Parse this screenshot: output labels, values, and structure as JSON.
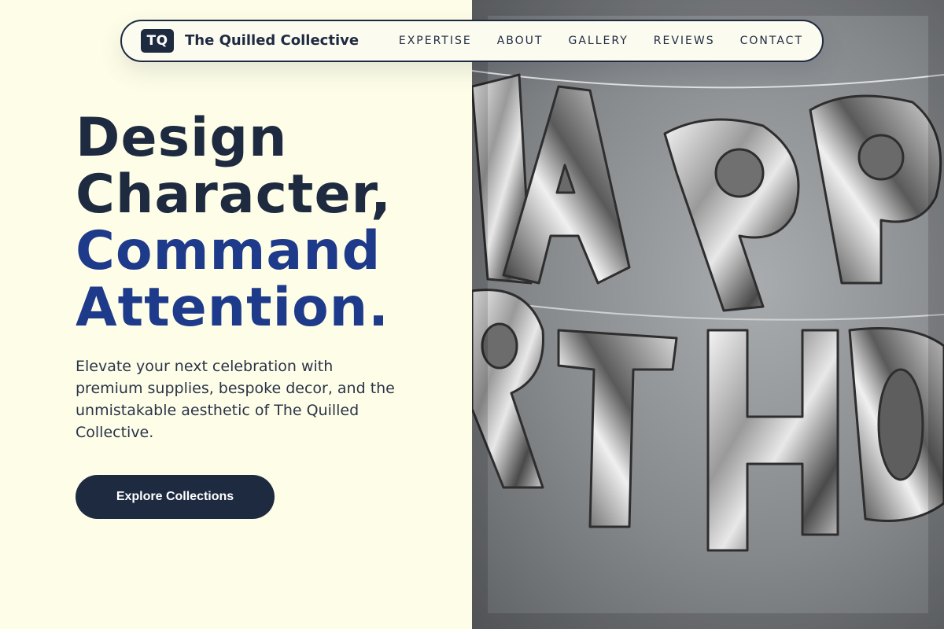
{
  "brand": {
    "badge": "TQ",
    "name": "The Quilled Collective"
  },
  "nav": {
    "items": [
      "EXPERTISE",
      "ABOUT",
      "GALLERY",
      "REVIEWS",
      "CONTACT"
    ]
  },
  "hero": {
    "headline_dark_1": "Design",
    "headline_dark_2": "Character,",
    "headline_blue_1": "Command",
    "headline_blue_2": "Attention.",
    "subcopy": "Elevate your next celebration with premium supplies, bespoke decor, and the unmistakable aesthetic of The Quilled Collective.",
    "cta_label": "Explore Collections"
  },
  "photo": {
    "top_row_letters": "APP",
    "bottom_row_letters": "RTHD"
  },
  "colors": {
    "cream": "#fefee8",
    "navy": "#1e2a40",
    "accent_blue": "#1e3a8a"
  }
}
